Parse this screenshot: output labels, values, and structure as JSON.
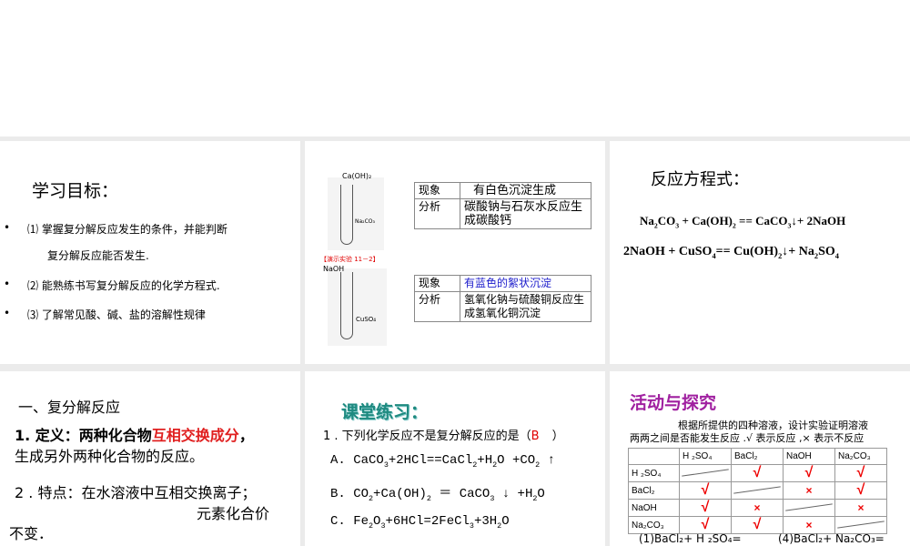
{
  "slide1": {
    "title": "学习目标：",
    "items": [
      {
        "bullet": "•",
        "text": "⑴ 掌握复分解反应发生的条件，并能判断",
        "cont": "复分解反应能否发生."
      },
      {
        "bullet": "•",
        "text": "⑵ 能熟练书写复分解反应的化学方程式."
      },
      {
        "bullet": "•",
        "text": "⑶ 了解常见酸、碱、盐的溶解性规律"
      }
    ]
  },
  "slide2": {
    "tube1_reagent": "Ca(OH)₂",
    "tube1_solution": "Na₂CO₃",
    "demo_label": "【演示实验 11－2】",
    "tube2_reagent": "NaOH",
    "tube2_solution": "CuSO₄",
    "table1": {
      "k1": "现象",
      "v1": "有白色沉淀生成",
      "k2": "分析",
      "v2": "碳酸钠与石灰水反应生成碳酸钙"
    },
    "table2": {
      "k1": "现象",
      "v1": "有蓝色的絮状沉淀",
      "k2": "分析",
      "v2": "氢氧化钠与硫酸铜反应生成氢氧化铜沉淀"
    },
    "blue": "#2020cc",
    "red": "#e00000"
  },
  "slide3": {
    "title": "反应方程式：",
    "eq1": [
      [
        "Na",
        "2"
      ],
      [
        "CO",
        "3"
      ],
      [
        " + Ca(OH)",
        "2"
      ],
      [
        " == CaCO",
        "3"
      ],
      [
        "↓+ 2NaOH",
        ""
      ]
    ],
    "eq2": [
      [
        "2NaOH + CuSO",
        "4"
      ],
      [
        "== Cu(OH)",
        "2"
      ],
      [
        "↓+ Na",
        "2"
      ],
      [
        "SO",
        "4"
      ]
    ]
  },
  "slide4": {
    "heading": "一、复分解反应",
    "def_prefix": "1. 定义：两种化合物",
    "def_red": "互相交换成分",
    "def_suffix": "，",
    "def_line2": "生成另外两种化合物的反应。",
    "feat_line1": "2 . 特点：在水溶液中互相交换离子；",
    "feat_line2": "元素化合价",
    "feat_line3": "不变．"
  },
  "slide5": {
    "title": "课堂练习：",
    "question": "1 . 下列化学反应不是复分解反应的是（",
    "answer": "B",
    "question_end": "）",
    "optA": [
      [
        "A. CaCO",
        "3"
      ],
      [
        "+2HCl==CaCl",
        "2"
      ],
      [
        "+H",
        "2"
      ],
      [
        "O  +CO",
        "2"
      ],
      [
        " ↑",
        ""
      ]
    ],
    "optB": [
      [
        "B. CO",
        "2"
      ],
      [
        "+Ca(OH)",
        "2"
      ],
      [
        " ＝ CaCO",
        "3"
      ],
      [
        " ↓ +H",
        "2"
      ],
      [
        "O",
        ""
      ]
    ],
    "optC": [
      [
        "C. Fe",
        "2"
      ],
      [
        "O",
        "3"
      ],
      [
        "+6HCl=2FeCl",
        "3"
      ],
      [
        "+3H",
        "2"
      ],
      [
        "O",
        ""
      ]
    ]
  },
  "slide6": {
    "title": "活动与探究",
    "desc1": "根据所提供的四种溶液，设计实验证明溶液",
    "desc2": "两两之间是否能发生反应 .√ 表示反应 ,× 表示不反应",
    "cols": [
      "H ₂SO₄",
      "BaCl₂",
      "NaOH",
      "Na₂CO₃"
    ],
    "rows": [
      "H ₂SO₄",
      "BaCl₂",
      "NaOH",
      "Na₂CO₃"
    ],
    "matrix": [
      [
        "-",
        "√",
        "√",
        "√"
      ],
      [
        "√",
        "-",
        "×",
        "√"
      ],
      [
        "√",
        "×",
        "-",
        "×"
      ],
      [
        "√",
        "√",
        "×",
        "-"
      ]
    ],
    "q1": "(1)BaCl₂+ H ₂SO₄=",
    "q4": "(4)BaCl₂+ Na₂CO₃="
  }
}
